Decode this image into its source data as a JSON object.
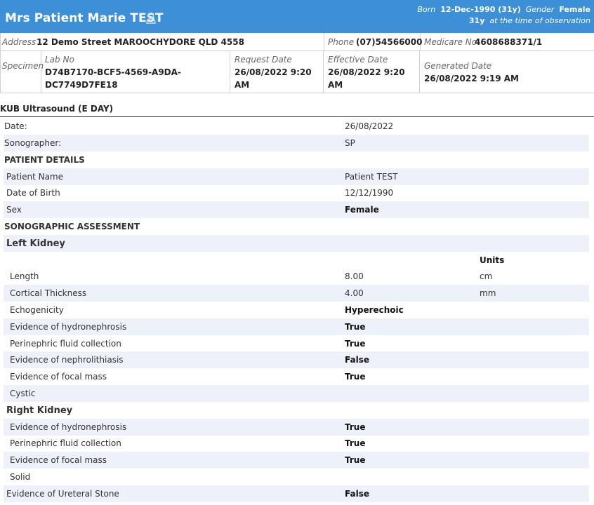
{
  "header": {
    "patient_name": "Mrs Patient Marie TEST",
    "born_label": "Born",
    "born_value": "12-Dec-1990 (31y)",
    "gender_label": "Gender",
    "gender_value": "Female",
    "age_value": "31y",
    "age_note": "at the time of observation"
  },
  "info": {
    "address_label": "Address",
    "address_value": "12 Demo Street MAROOCHYDORE QLD 4558",
    "phone_label": "Phone",
    "phone_value": "(07)54566000",
    "medicare_label": "Medicare No",
    "medicare_value": "4608688371/1",
    "specimen_label": "Specimen",
    "lab_no_label": "Lab No",
    "lab_no_value_1": "D74B7170-BCF5-4569-A9DA-",
    "lab_no_value_2": "DC7749D7FE18",
    "request_date_label": "Request Date",
    "request_date_value_1": "26/08/2022 9:20",
    "request_date_value_2": "AM",
    "effective_date_label": "Effective Date",
    "effective_date_value_1": "26/08/2022 9:20",
    "effective_date_value_2": "AM",
    "generated_date_label": "Generated Date",
    "generated_date_value": "26/08/2022 9:19 AM"
  },
  "report": {
    "title": "KUB Ultrasound (E DAY)",
    "date_label": "Date:",
    "date_value": "26/08/2022",
    "sonographer_label": "Sonographer:",
    "sonographer_value": "SP",
    "patient_details_heading": "PATIENT DETAILS",
    "patient_name_label": "Patient Name",
    "patient_name_value": "Patient TEST",
    "dob_label": "Date of Birth",
    "dob_value": "12/12/1990",
    "sex_label": "Sex",
    "sex_value": "Female",
    "sono_heading": "SONOGRAPHIC ASSESSMENT",
    "left_kidney_heading": "Left Kidney",
    "units_header": "Units",
    "left_rows": [
      {
        "label": "Length",
        "value": "8.00",
        "unit": "cm"
      },
      {
        "label": "Cortical Thickness",
        "value": "4.00",
        "unit": "mm"
      },
      {
        "label": "Echogenicity",
        "value": "Hyperechoic",
        "unit": ""
      },
      {
        "label": "Evidence of hydronephrosis",
        "value": "True",
        "unit": ""
      },
      {
        "label": "Perinephric fluid collection",
        "value": "True",
        "unit": ""
      },
      {
        "label": "Evidence of nephrolithiasis",
        "value": "False",
        "unit": ""
      },
      {
        "label": "Evidence of focal mass",
        "value": "True",
        "unit": ""
      },
      {
        "label": "Cystic",
        "value": "",
        "unit": ""
      }
    ],
    "right_kidney_heading": "Right Kidney",
    "right_rows": [
      {
        "label": "Evidence of hydronephrosis",
        "value": "True"
      },
      {
        "label": "Perinephric fluid collection",
        "value": "True"
      },
      {
        "label": "Evidence of focal mass",
        "value": "True"
      },
      {
        "label": "Solid",
        "value": ""
      }
    ],
    "ureteral_label": "Evidence of Ureteral Stone",
    "ureteral_value": "False"
  },
  "colors": {
    "header_bg": "#3d8fd8",
    "heading_blue": "#1a1aa6",
    "row_alt": "#eef0fa"
  }
}
